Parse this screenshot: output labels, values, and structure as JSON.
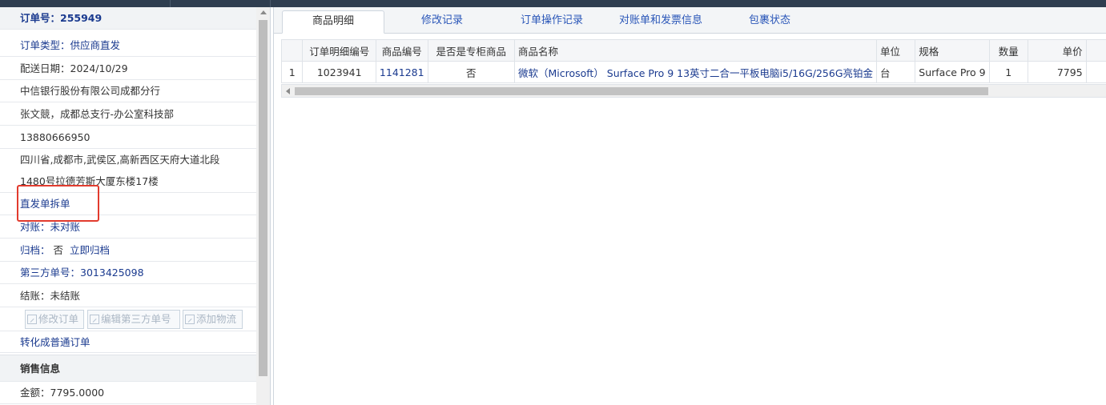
{
  "order": {
    "order_no_label": "订单号：255949",
    "type_label": "订单类型：",
    "type_value": "供应商直发",
    "delivery_date": "配送日期：2024/10/29",
    "company": "中信银行股份有限公司成都分行",
    "contact": "张文競，成都总支行-办公室科技部",
    "phone": "13880666950",
    "address_line1": "四川省,成都市,武侯区,高新西区天府大道北段",
    "address_line2": "1480号拉德芳斯大厦东楼17楼",
    "split_link": "直发单拆单",
    "reconcile_label": "对账：",
    "reconcile_value": "未对账",
    "archive_label": "归档：",
    "archive_value": "否",
    "archive_action": "立即归档",
    "third_party_label": "第三方单号：",
    "third_party_value": "3013425098",
    "settle_label": "结账：",
    "settle_value": "未结账",
    "buttons": {
      "modify_order": "修改订单",
      "edit_third_party": "编辑第三方单号",
      "add_logistics": "添加物流"
    },
    "convert_link": "转化成普通订单"
  },
  "sales": {
    "header": "销售信息",
    "amount": "金额：7795.0000"
  },
  "tabs": [
    {
      "label": "商品明细",
      "active": true
    },
    {
      "label": "修改记录",
      "active": false
    },
    {
      "label": "订单操作记录",
      "active": false
    },
    {
      "label": "对账单和发票信息",
      "active": false
    },
    {
      "label": "包裹状态",
      "active": false
    }
  ],
  "table": {
    "columns": [
      "",
      "订单明细编号",
      "商品编号",
      "是否是专柜商品",
      "商品名称",
      "单位",
      "规格",
      "数量",
      "单价"
    ],
    "rows": [
      {
        "row_no": "1",
        "detail_id": "1023941",
        "product_id": "1141281",
        "is_counter": "否",
        "product_name": "微软（Microsoft） Surface Pro 9 13英寸二合一平板电脑i5/16G/256G亮铂金",
        "unit": "台",
        "spec": "Surface Pro 9",
        "qty": "1",
        "price": "7795"
      }
    ]
  },
  "colors": {
    "link_blue": "#1a3a8f",
    "tab_blue": "#2a56b8",
    "highlight_red": "#e23b2e",
    "topbar": "#2f3e50"
  }
}
